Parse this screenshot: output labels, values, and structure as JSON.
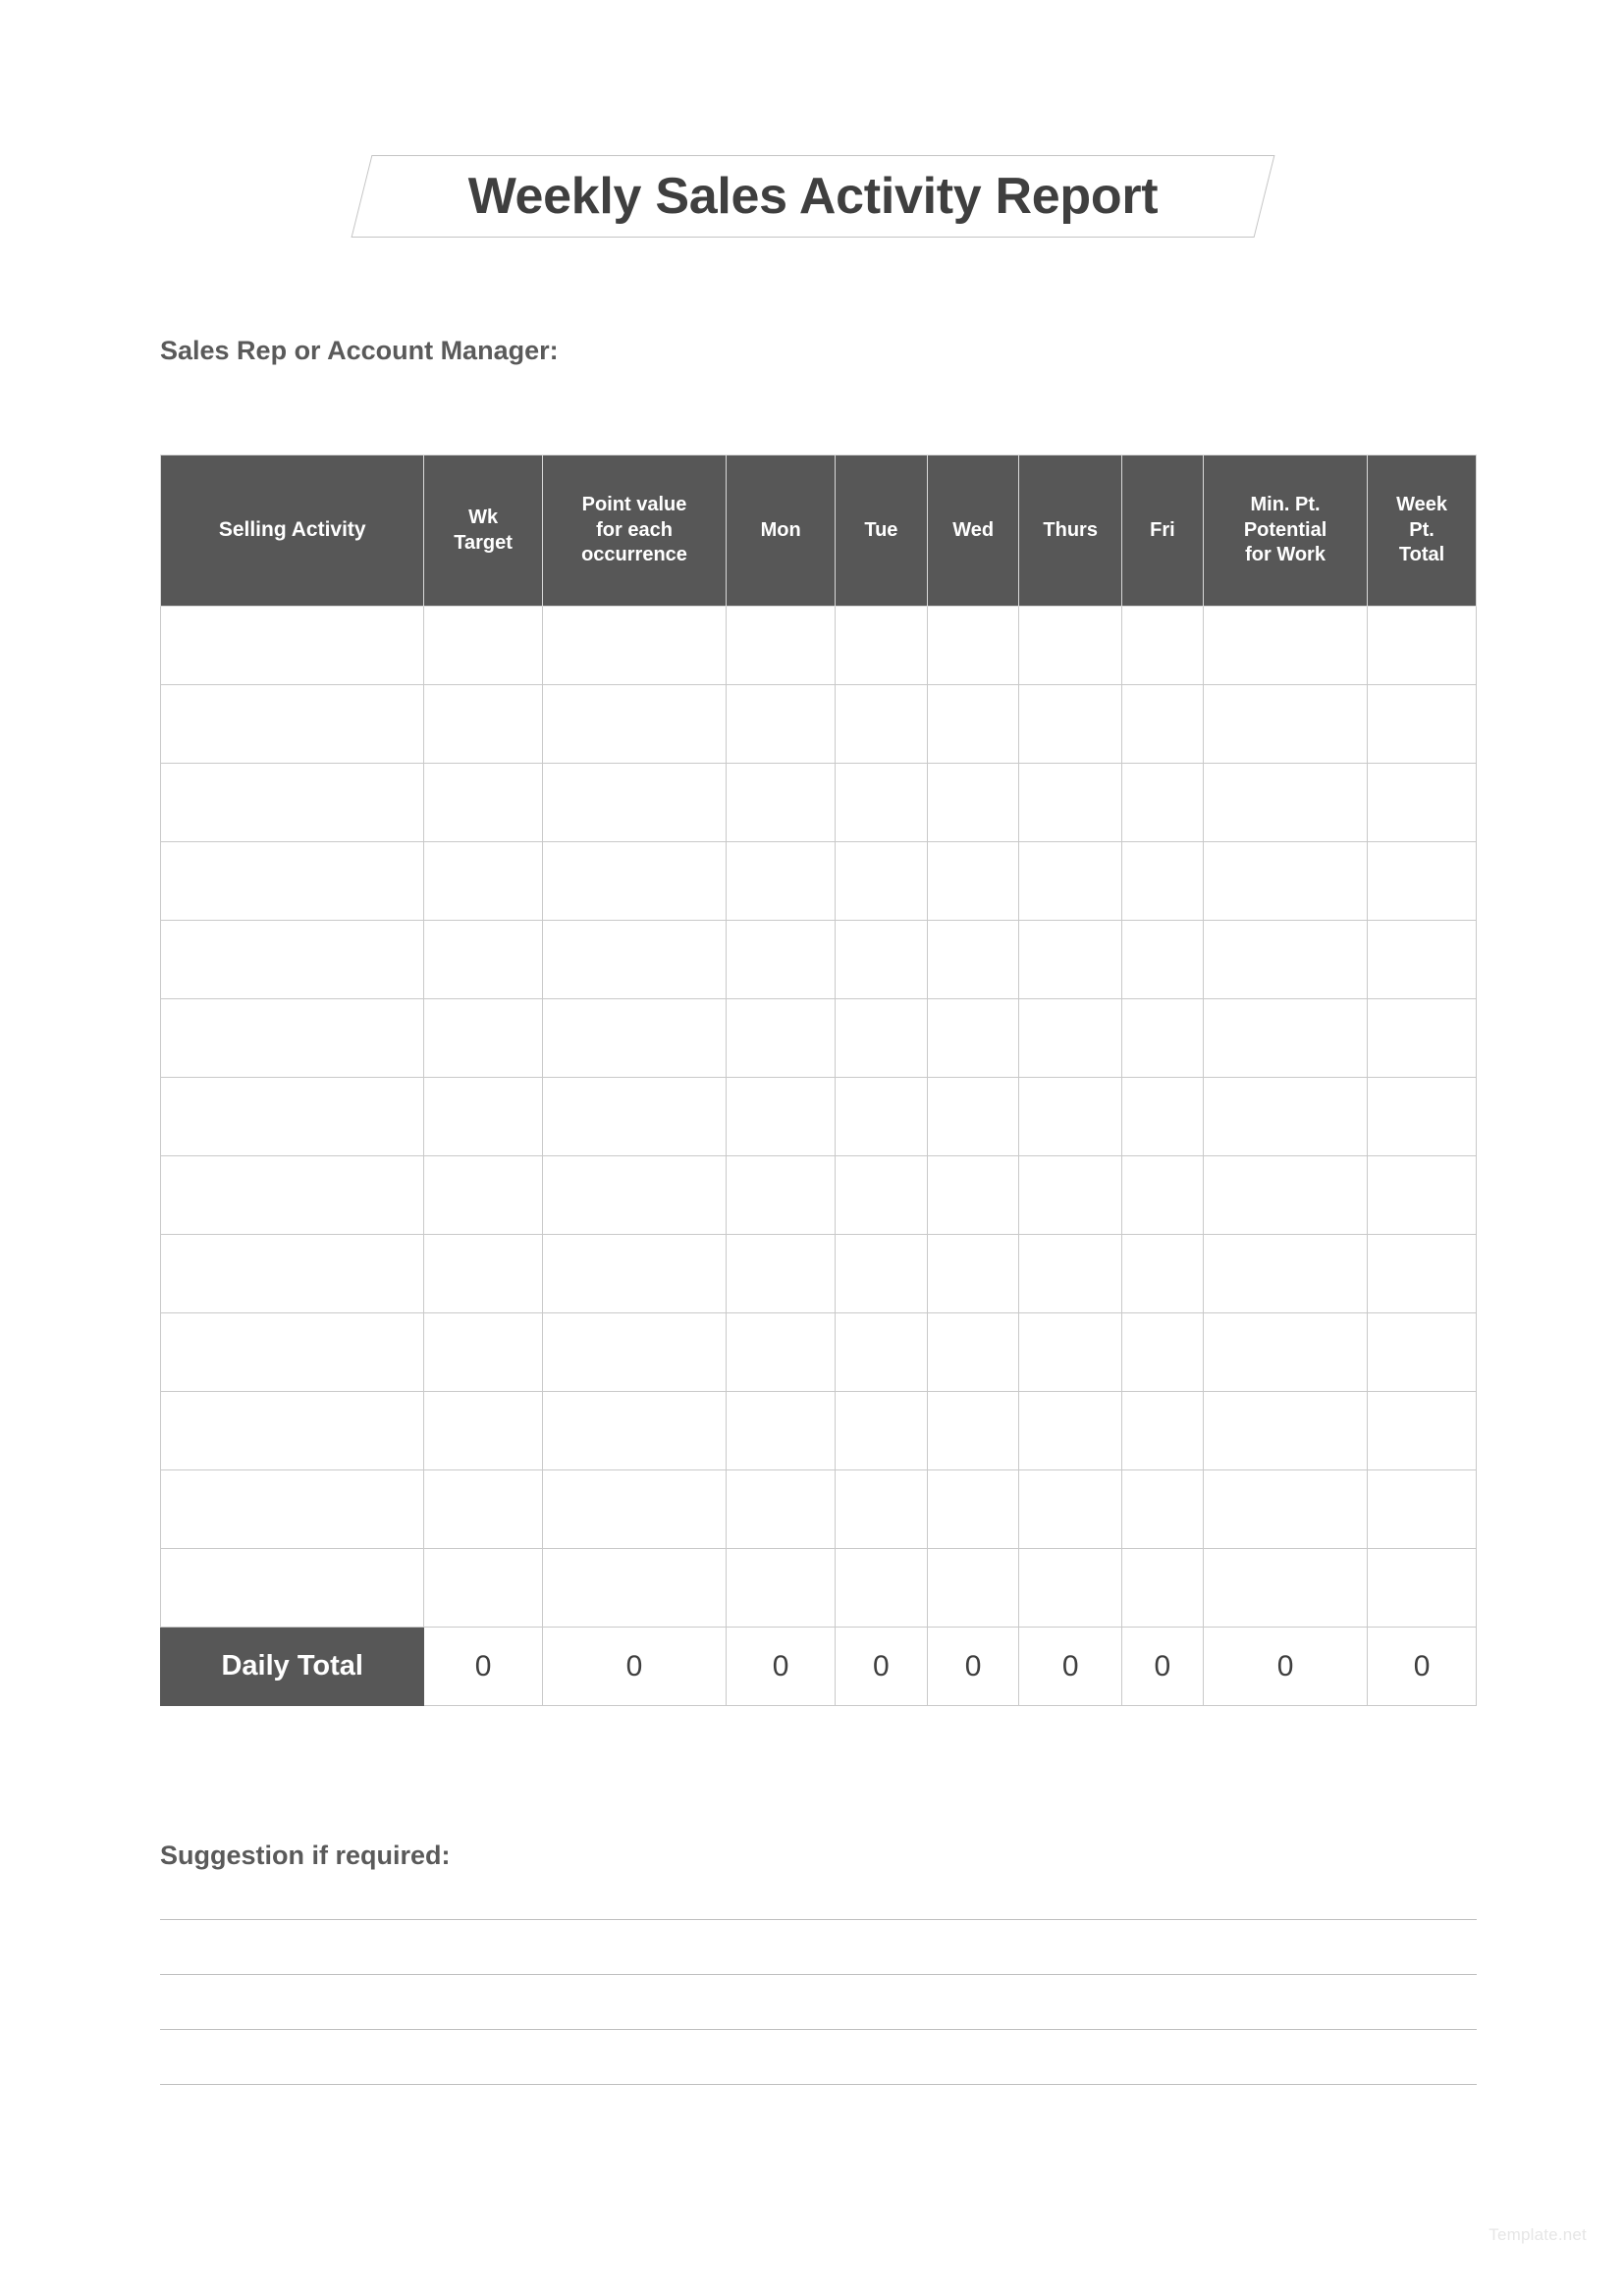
{
  "document": {
    "title": "Weekly Sales Activity Report",
    "rep_label": "Sales Rep or Account Manager:",
    "suggestion_label": "Suggestion if required:",
    "watermark": "Template.net"
  },
  "colors": {
    "header_fill": "#575757",
    "header_text": "#ffffff",
    "grid_line": "#c9c9c9",
    "body_text": "#5a5a5a",
    "title_text": "#3f3f3f",
    "rule_line": "#bfbfbf",
    "watermark_text": "#e6e6e6"
  },
  "table": {
    "columns": [
      {
        "key": "activity",
        "label": "Selling Activity"
      },
      {
        "key": "wk_target",
        "label": "Wk\nTarget"
      },
      {
        "key": "point_value",
        "label": "Point value\nfor each\noccurrence"
      },
      {
        "key": "mon",
        "label": "Mon"
      },
      {
        "key": "tue",
        "label": "Tue"
      },
      {
        "key": "wed",
        "label": "Wed"
      },
      {
        "key": "thurs",
        "label": "Thurs"
      },
      {
        "key": "fri",
        "label": "Fri"
      },
      {
        "key": "min_pt",
        "label": "Min. Pt.\nPotential\nfor Work"
      },
      {
        "key": "week_pt",
        "label": "Week\nPt.\nTotal"
      }
    ],
    "empty_row_count": 13,
    "rows": [
      [
        "",
        "",
        "",
        "",
        "",
        "",
        "",
        "",
        "",
        ""
      ],
      [
        "",
        "",
        "",
        "",
        "",
        "",
        "",
        "",
        "",
        ""
      ],
      [
        "",
        "",
        "",
        "",
        "",
        "",
        "",
        "",
        "",
        ""
      ],
      [
        "",
        "",
        "",
        "",
        "",
        "",
        "",
        "",
        "",
        ""
      ],
      [
        "",
        "",
        "",
        "",
        "",
        "",
        "",
        "",
        "",
        ""
      ],
      [
        "",
        "",
        "",
        "",
        "",
        "",
        "",
        "",
        "",
        ""
      ],
      [
        "",
        "",
        "",
        "",
        "",
        "",
        "",
        "",
        "",
        ""
      ],
      [
        "",
        "",
        "",
        "",
        "",
        "",
        "",
        "",
        "",
        ""
      ],
      [
        "",
        "",
        "",
        "",
        "",
        "",
        "",
        "",
        "",
        ""
      ],
      [
        "",
        "",
        "",
        "",
        "",
        "",
        "",
        "",
        "",
        ""
      ],
      [
        "",
        "",
        "",
        "",
        "",
        "",
        "",
        "",
        "",
        ""
      ],
      [
        "",
        "",
        "",
        "",
        "",
        "",
        "",
        "",
        "",
        ""
      ],
      [
        "",
        "",
        "",
        "",
        "",
        "",
        "",
        "",
        "",
        ""
      ]
    ],
    "total_row": {
      "label": "Daily Total",
      "values": [
        "0",
        "0",
        "0",
        "0",
        "0",
        "0",
        "0",
        "0",
        "0"
      ]
    }
  },
  "suggestion": {
    "line_count": 4
  }
}
